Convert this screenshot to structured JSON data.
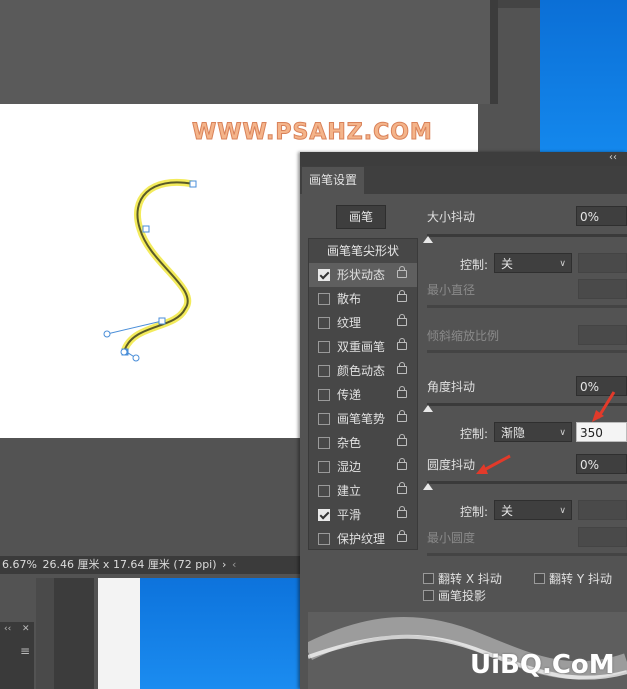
{
  "watermark": "WWW.PSAHZ.COM",
  "watermark_bottom": "UiBQ.CoM",
  "status": {
    "zoom": "6.67%",
    "doc_size": "26.46 厘米 x 17.64 厘米 (72 ppi)",
    "arrow": "›",
    "arrow2": "‹"
  },
  "panel": {
    "collapse": "‹‹",
    "tab": "画笔设置",
    "brush_button": "画笔",
    "list_header": "画笔笔尖形状",
    "items": [
      {
        "label": "形状动态",
        "checked": true
      },
      {
        "label": "散布",
        "checked": false
      },
      {
        "label": "纹理",
        "checked": false
      },
      {
        "label": "双重画笔",
        "checked": false
      },
      {
        "label": "颜色动态",
        "checked": false
      },
      {
        "label": "传递",
        "checked": false
      },
      {
        "label": "画笔笔势",
        "checked": false
      },
      {
        "label": "杂色",
        "checked": false
      },
      {
        "label": "湿边",
        "checked": false
      },
      {
        "label": "建立",
        "checked": false
      },
      {
        "label": "平滑",
        "checked": true
      },
      {
        "label": "保护纹理",
        "checked": false
      }
    ],
    "size_jitter_label": "大小抖动",
    "size_jitter_value": "0%",
    "control_label": "控制:",
    "control_value_off": "关",
    "min_diameter_label": "最小直径",
    "tilt_scale_label": "倾斜缩放比例",
    "angle_jitter_label": "角度抖动",
    "angle_jitter_value": "0%",
    "control_value_fade": "渐隐",
    "fade_steps": "350",
    "roundness_jitter_label": "圆度抖动",
    "roundness_jitter_value": "0%",
    "min_roundness_label": "最小圆度",
    "flip_x": "翻转 X 抖动",
    "flip_y": "翻转 Y 抖动",
    "brush_projection": "画笔投影"
  },
  "mini_panel": {
    "tabs": "‹‹",
    "close": "✕",
    "menu": "≡"
  },
  "colors": {
    "panel_bg": "#535353",
    "stroke": "#e8dc28",
    "path": "#4a8ed8",
    "annotation": "#e23a2a"
  }
}
